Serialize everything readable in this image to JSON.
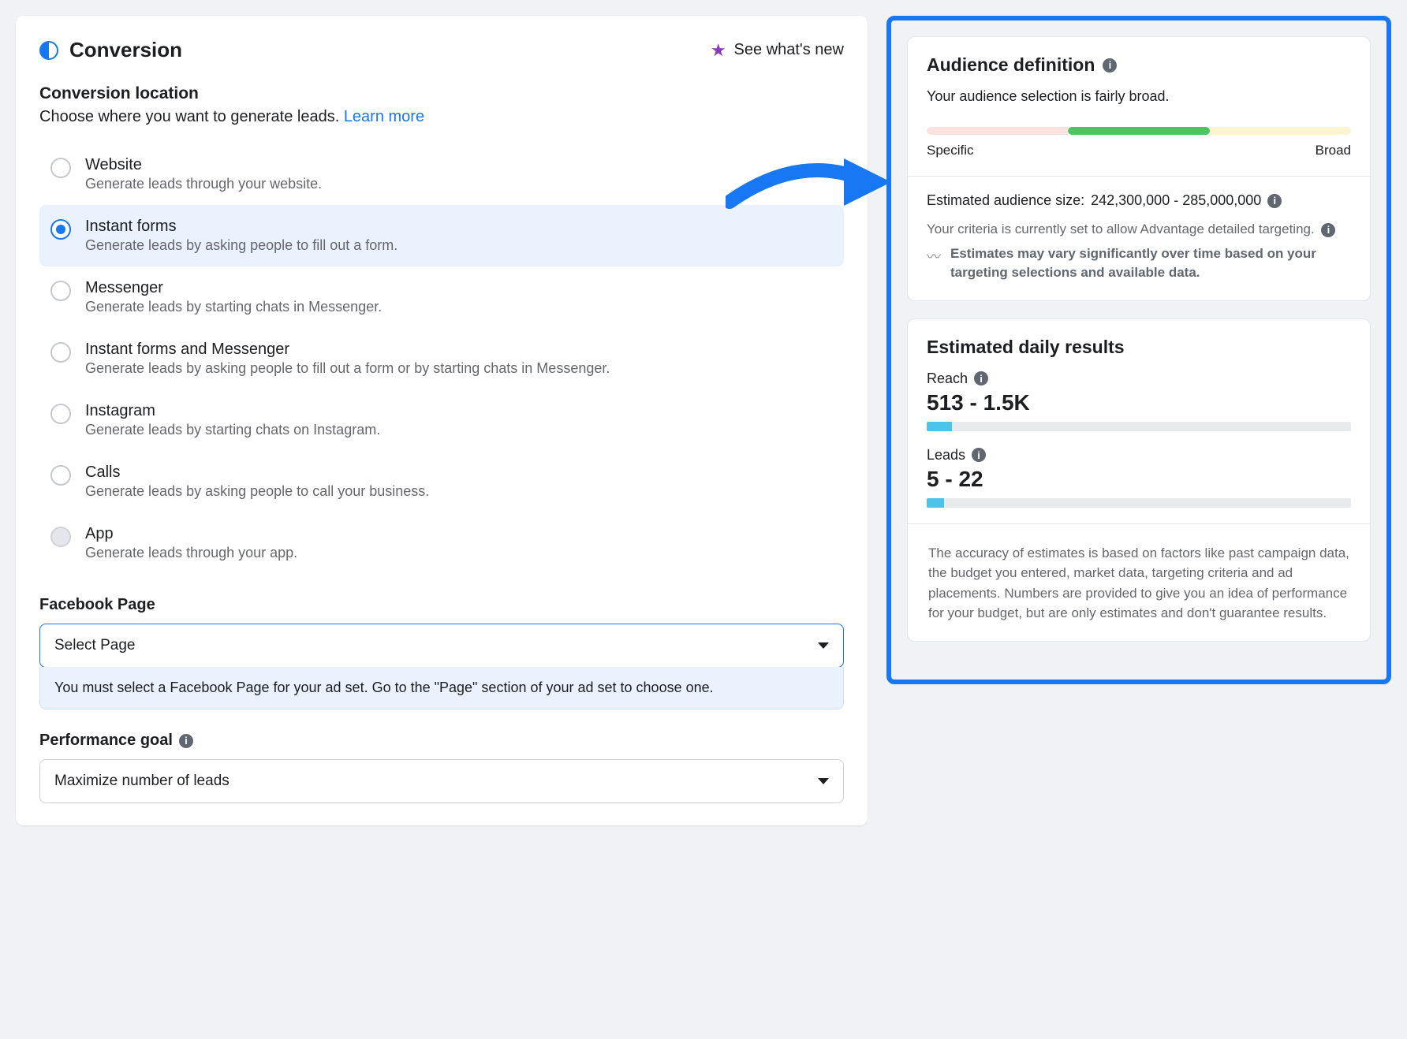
{
  "header": {
    "title": "Conversion",
    "whats_new": "See what's new"
  },
  "conversion_location": {
    "heading": "Conversion location",
    "description": "Choose where you want to generate leads. ",
    "learn_more": "Learn more",
    "options": [
      {
        "label": "Website",
        "desc": "Generate leads through your website."
      },
      {
        "label": "Instant forms",
        "desc": "Generate leads by asking people to fill out a form."
      },
      {
        "label": "Messenger",
        "desc": "Generate leads by starting chats in Messenger."
      },
      {
        "label": "Instant forms and Messenger",
        "desc": "Generate leads by asking people to fill out a form or by starting chats in Messenger."
      },
      {
        "label": "Instagram",
        "desc": "Generate leads by starting chats on Instagram."
      },
      {
        "label": "Calls",
        "desc": "Generate leads by asking people to call your business."
      },
      {
        "label": "App",
        "desc": "Generate leads through your app."
      }
    ]
  },
  "facebook_page": {
    "heading": "Facebook Page",
    "placeholder": "Select Page",
    "warning": "You must select a Facebook Page for your ad set. Go to the \"Page\" section of your ad set to choose one."
  },
  "performance_goal": {
    "heading": "Performance goal",
    "value": "Maximize number of leads"
  },
  "audience": {
    "heading": "Audience definition",
    "desc": "Your audience selection is fairly broad.",
    "label_specific": "Specific",
    "label_broad": "Broad",
    "est_size_label": "Estimated audience size:",
    "est_size_value": "242,300,000 - 285,000,000",
    "criteria_note": "Your criteria is currently set to allow Advantage detailed targeting.",
    "vary_note": "Estimates may vary significantly over time based on your targeting selections and available data."
  },
  "daily": {
    "heading": "Estimated daily results",
    "reach_label": "Reach",
    "reach_value": "513 - 1.5K",
    "reach_pct": 6,
    "leads_label": "Leads",
    "leads_value": "5 - 22",
    "leads_pct": 4,
    "disclaimer": "The accuracy of estimates is based on factors like past campaign data, the budget you entered, market data, targeting criteria and ad placements. Numbers are provided to give you an idea of performance for your budget, but are only estimates and don't guarantee results."
  }
}
